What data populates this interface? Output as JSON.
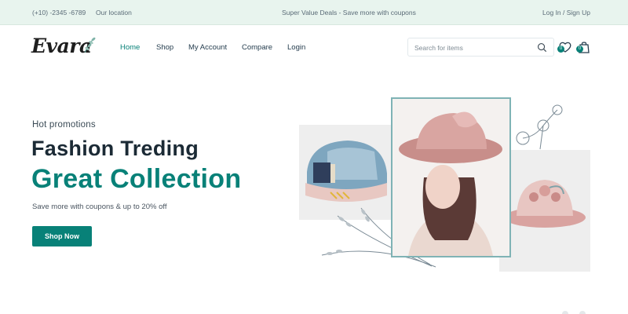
{
  "topbar": {
    "phone": "(+10) -2345 -6789",
    "location": "Our location",
    "deals": "Super Value Deals - Save more with coupons",
    "auth": "Log In / Sign Up"
  },
  "header": {
    "logo_text": "Evara",
    "nav": {
      "home": "Home",
      "shop": "Shop",
      "account": "My Account",
      "compare": "Compare",
      "login": "Login"
    },
    "search": {
      "placeholder": "Search for items"
    },
    "wishlist_count": "0",
    "cart_count": "0"
  },
  "hero": {
    "subtitle": "Hot promotions",
    "title_line1": "Fashion Treding",
    "title_line2": "Great Collection",
    "description": "Save more with coupons & up to 20% off",
    "button": "Shop Now"
  },
  "colors": {
    "brand": "#088178",
    "topbar_bg": "#e8f4ee",
    "heading": "#1b2a35"
  },
  "icons": [
    "leaf-icon",
    "search-icon",
    "heart-icon",
    "shopping-bag-icon"
  ]
}
